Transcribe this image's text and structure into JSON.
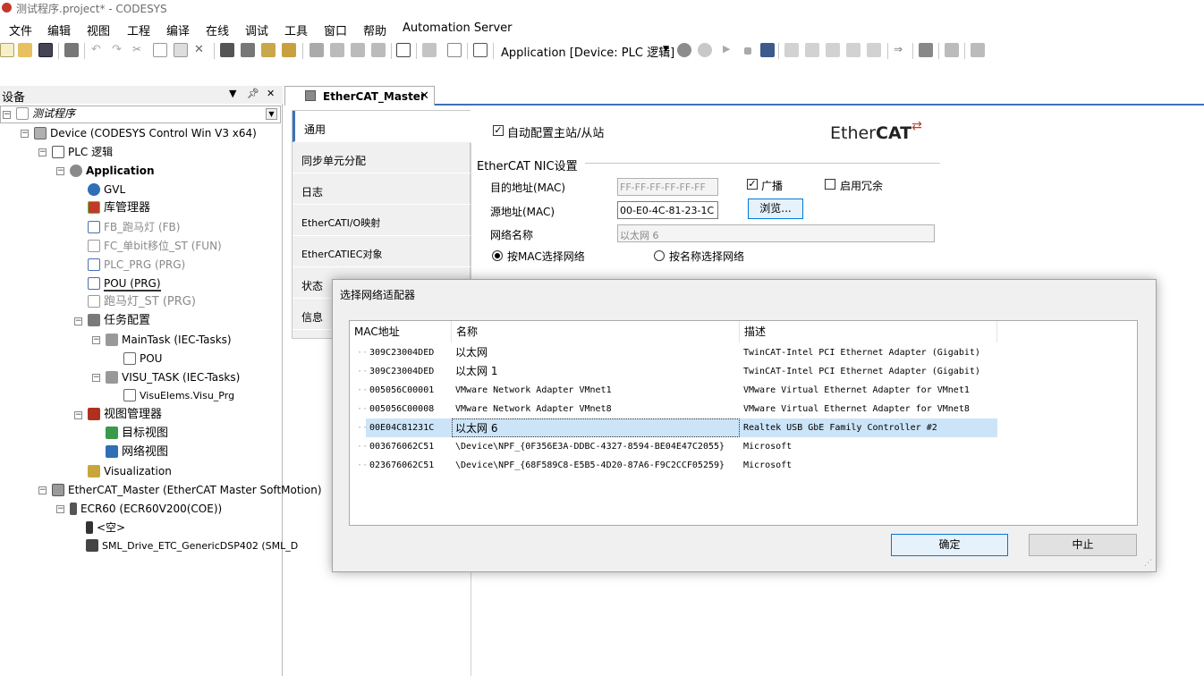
{
  "window": {
    "title": "测试程序.project* - CODESYS"
  },
  "menu": [
    "文件",
    "编辑",
    "视图",
    "工程",
    "编译",
    "在线",
    "调试",
    "工具",
    "窗口",
    "帮助",
    "Automation Server"
  ],
  "toolbar": {
    "app_combo": "Application [Device: PLC 逻辑]"
  },
  "devices_panel": {
    "title": "设备",
    "tree": [
      {
        "label": "测试程序"
      },
      {
        "label": "Device (CODESYS Control Win V3 x64)"
      },
      {
        "label": "PLC 逻辑"
      },
      {
        "label": "Application"
      },
      {
        "label": "GVL"
      },
      {
        "label": "库管理器"
      },
      {
        "label": "FB_跑马灯 (FB)"
      },
      {
        "label": "FC_单bit移位_ST (FUN)"
      },
      {
        "label": "PLC_PRG (PRG)"
      },
      {
        "label": "POU (PRG)"
      },
      {
        "label": "跑马灯_ST (PRG)"
      },
      {
        "label": "任务配置"
      },
      {
        "label": "MainTask (IEC-Tasks)"
      },
      {
        "label": "POU"
      },
      {
        "label": "VISU_TASK (IEC-Tasks)"
      },
      {
        "label": "VisuElems.Visu_Prg"
      },
      {
        "label": "视图管理器"
      },
      {
        "label": "目标视图"
      },
      {
        "label": "网络视图"
      },
      {
        "label": "Visualization"
      },
      {
        "label": "EtherCAT_Master (EtherCAT Master SoftMotion)"
      },
      {
        "label": "ECR60 (ECR60V200(COE))"
      },
      {
        "label": "<空>"
      },
      {
        "label": "SML_Drive_ETC_GenericDSP402 (SML_D"
      }
    ]
  },
  "editor": {
    "tab_label": "EtherCAT_Master",
    "nav": [
      "通用",
      "同步单元分配",
      "日志",
      "EtherCATI/O映射",
      "EtherCATIEC对象",
      "状态",
      "信息"
    ],
    "auto_config_label": "自动配置主站/从站",
    "logo_text_plain": "Ether",
    "logo_text_bold": "CAT",
    "nic_section": "EtherCAT NIC设置",
    "dest_label": "目的地址(MAC)",
    "dest_value": "FF-FF-FF-FF-FF-FF",
    "broadcast_label": "广播",
    "redundancy_label": "启用冗余",
    "src_label": "源地址(MAC)",
    "src_value": "00-E0-4C-81-23-1C",
    "browse_label": "浏览...",
    "netname_label": "网络名称",
    "netname_value": "以太网 6",
    "radio_mac_label": "按MAC选择网络",
    "radio_name_label": "按名称选择网络"
  },
  "dialog": {
    "title": "选择网络适配器",
    "columns": [
      "MAC地址",
      "名称",
      "描述"
    ],
    "rows": [
      {
        "mac": "309C23004DED",
        "name": "以太网",
        "desc": "TwinCAT-Intel PCI Ethernet Adapter (Gigabit)"
      },
      {
        "mac": "309C23004DED",
        "name": "以太网 1",
        "desc": "TwinCAT-Intel PCI Ethernet Adapter (Gigabit)"
      },
      {
        "mac": "005056C00001",
        "name": "VMware Network Adapter VMnet1",
        "desc": "VMware Virtual Ethernet Adapter for VMnet1"
      },
      {
        "mac": "005056C00008",
        "name": "VMware Network Adapter VMnet8",
        "desc": "VMware Virtual Ethernet Adapter for VMnet8"
      },
      {
        "mac": "00E04C81231C",
        "name": "以太网 6",
        "desc": "Realtek USB GbE Family Controller #2"
      },
      {
        "mac": "003676062C51",
        "name": "\\Device\\NPF_{0F356E3A-DDBC-4327-8594-BE04E47C2055}",
        "desc": "Microsoft"
      },
      {
        "mac": "023676062C51",
        "name": "\\Device\\NPF_{68F589C8-E5B5-4D20-87A6-F9C2CCF05259}",
        "desc": "Microsoft"
      }
    ],
    "ok_label": "确定",
    "cancel_label": "中止"
  }
}
